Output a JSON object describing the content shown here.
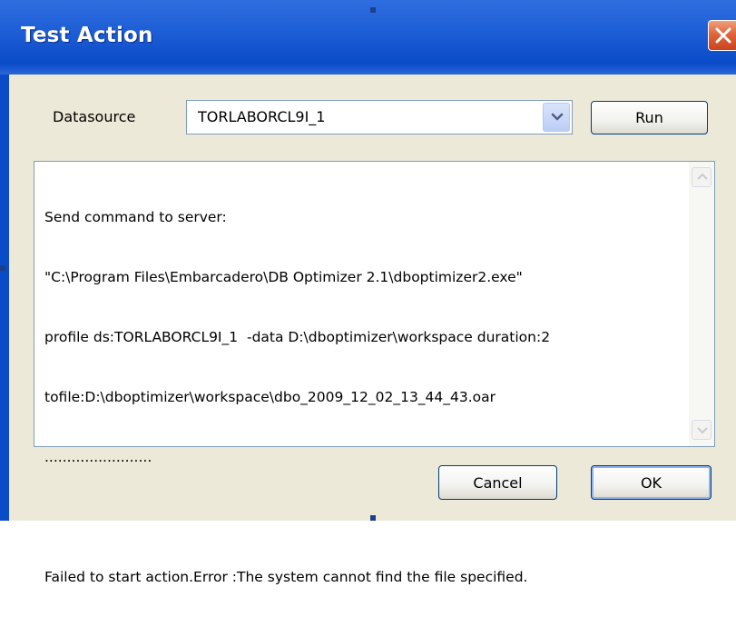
{
  "window": {
    "title": "Test Action"
  },
  "datasource": {
    "label": "Datasource",
    "selected": "TORLABORCL9I_1"
  },
  "buttons": {
    "run": "Run",
    "cancel": "Cancel",
    "ok": "OK"
  },
  "output": {
    "lines": [
      "Send command to server:",
      "\"C:\\Program Files\\Embarcadero\\DB Optimizer 2.1\\dboptimizer2.exe\"",
      "profile ds:TORLABORCL9I_1  -data D:\\dboptimizer\\workspace duration:2",
      "tofile:D:\\dboptimizer\\workspace\\dbo_2009_12_02_13_44_43.oar",
      "........................",
      "",
      "Failed to start action.Error :The system cannot find the file specified."
    ]
  },
  "icons": {
    "close": "close-icon",
    "dropdown": "chevron-down-icon",
    "scroll_up": "scroll-up-icon",
    "scroll_down": "scroll-down-icon"
  },
  "colors": {
    "titlebar": "#0a4cc8",
    "client": "#ece9d8",
    "close_button": "#e0653a"
  }
}
